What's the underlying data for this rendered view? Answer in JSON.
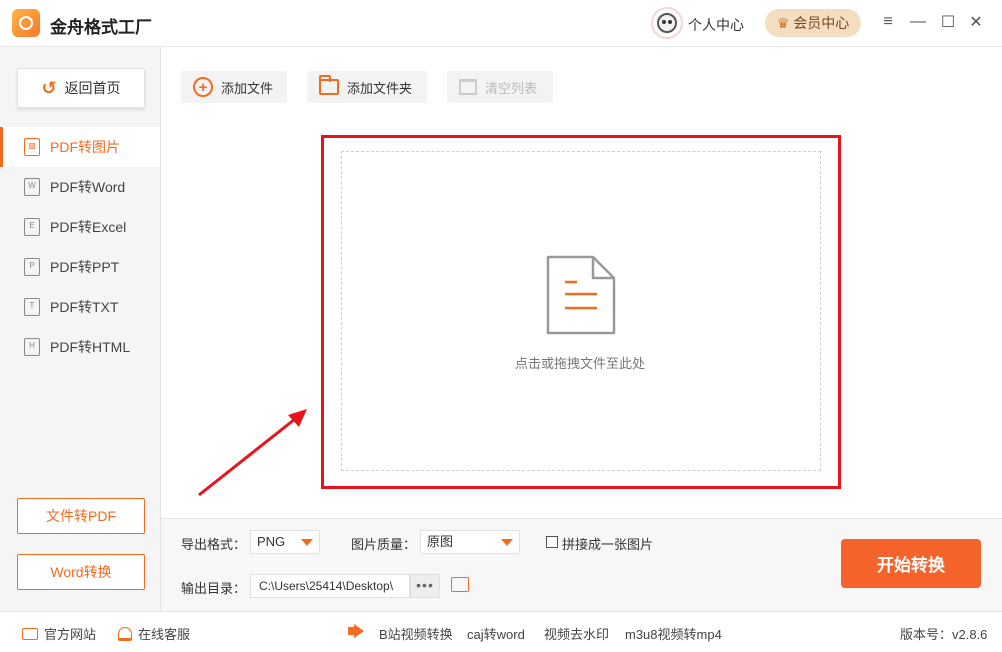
{
  "app": {
    "title": "金舟格式工厂"
  },
  "header": {
    "user_center": "个人中心",
    "vip_center": "会员中心",
    "icons": [
      "menu-icon",
      "minimize-icon",
      "maximize-icon",
      "close-icon"
    ]
  },
  "sidebar": {
    "back_label": "返回首页",
    "items": [
      {
        "label": "PDF转图片",
        "icon": "image-file-icon",
        "active": true
      },
      {
        "label": "PDF转Word",
        "icon": "word-file-icon",
        "active": false
      },
      {
        "label": "PDF转Excel",
        "icon": "excel-file-icon",
        "active": false
      },
      {
        "label": "PDF转PPT",
        "icon": "ppt-file-icon",
        "active": false
      },
      {
        "label": "PDF转TXT",
        "icon": "txt-file-icon",
        "active": false
      },
      {
        "label": "PDF转HTML",
        "icon": "html-file-icon",
        "active": false
      }
    ],
    "bottom_buttons": [
      "文件转PDF",
      "Word转换"
    ]
  },
  "toolbar": {
    "add_file": "添加文件",
    "add_folder": "添加文件夹",
    "clear_list": "清空列表"
  },
  "dropzone": {
    "text": "点击或拖拽文件至此处"
  },
  "settings": {
    "format_label": "导出格式：",
    "format_value": "PNG",
    "quality_label": "图片质量：",
    "quality_value": "原图",
    "merge_label": "拼接成一张图片",
    "merge_checked": false,
    "output_label": "输出目录：",
    "output_path": "C:\\Users\\25414\\Desktop\\",
    "more_label": "•••",
    "start_label": "开始转换"
  },
  "footer": {
    "official_site": "官方网站",
    "online_service": "在线客服",
    "links": [
      "B站视频转换",
      "caj转word",
      "视频去水印",
      "m3u8视频转mp4"
    ],
    "version": "版本号：v2.8.6"
  },
  "colors": {
    "accent": "#f26b21",
    "highlight_red": "#e8141a",
    "start_button": "#f4632a"
  }
}
